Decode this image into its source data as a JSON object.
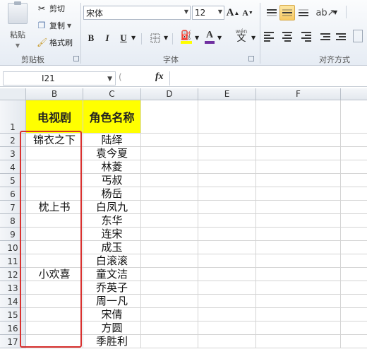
{
  "ribbon": {
    "clipboard": {
      "paste_label": "粘贴",
      "cut_label": "剪切",
      "copy_label": "复制",
      "format_painter_label": "格式刷",
      "group_label": "剪贴板"
    },
    "font": {
      "font_name": "宋体",
      "font_size": "12",
      "bold": "B",
      "italic": "I",
      "underline": "U",
      "phonetic": "wén",
      "phonetic_char": "文",
      "group_label": "字体"
    },
    "alignment": {
      "group_label": "对齐方式"
    }
  },
  "formula_bar": {
    "name_box": "I21",
    "fx_label": "fx",
    "value": ""
  },
  "sheet": {
    "columns": [
      "B",
      "C",
      "D",
      "E",
      "F"
    ],
    "rows": [
      "1",
      "2",
      "3",
      "4",
      "5",
      "6",
      "7",
      "8",
      "9",
      "10",
      "11",
      "12",
      "13",
      "14",
      "15",
      "16",
      "17"
    ],
    "header_row": {
      "b": "电视剧",
      "c": "角色名称"
    },
    "dramas": [
      {
        "row": 2,
        "text": "锦衣之下"
      },
      {
        "row": 7,
        "text": "枕上书"
      },
      {
        "row": 12,
        "text": "小欢喜"
      }
    ],
    "characters": [
      "陆绎",
      "袁今夏",
      "林菱",
      "丐叔",
      "杨岳",
      "白凤九",
      "东华",
      "连宋",
      "成玉",
      "白滚滚",
      "童文洁",
      "乔英子",
      "周一凡",
      "宋倩",
      "方圆",
      "季胜利"
    ]
  },
  "colors": {
    "header_fill": "#ffff00",
    "highlight_border": "#d9312f",
    "ribbon_active": "#f8c962"
  }
}
